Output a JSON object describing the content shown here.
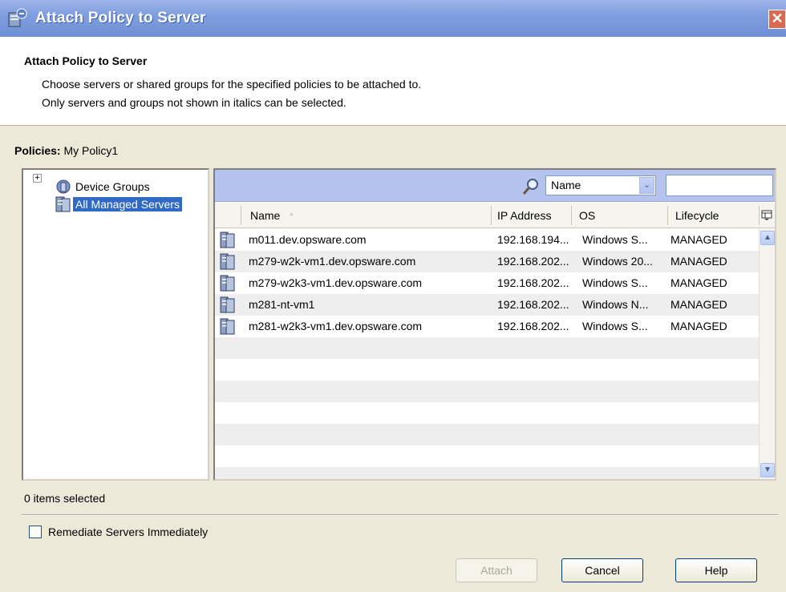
{
  "window": {
    "title": "Attach Policy to Server",
    "close_glyph": "✕"
  },
  "header": {
    "title": "Attach Policy to Server",
    "line1": "Choose servers or shared groups for the specified policies to be attached to.",
    "line2": "Only servers and groups not shown in italics can be selected."
  },
  "policies": {
    "label": "Policies:",
    "value": "My Policy1"
  },
  "tree": {
    "expander": "+",
    "items": [
      {
        "label": "Device Groups",
        "icon": "device-groups-icon"
      },
      {
        "label": "All Managed Servers",
        "icon": "server-icon"
      }
    ]
  },
  "search": {
    "field_selected": "Name",
    "field_arrow": "⌄",
    "query": ""
  },
  "table": {
    "columns": [
      {
        "label": "Name",
        "sort_glyph": "▲"
      },
      {
        "label": "IP Address"
      },
      {
        "label": "OS"
      },
      {
        "label": "Lifecycle"
      }
    ],
    "rows": [
      {
        "name": "m011.dev.opsware.com",
        "ip": "192.168.194...",
        "os": "Windows S...",
        "lifecycle": "MANAGED"
      },
      {
        "name": "m279-w2k-vm1.dev.opsware.com",
        "ip": "192.168.202...",
        "os": "Windows 20...",
        "lifecycle": "MANAGED"
      },
      {
        "name": "m279-w2k3-vm1.dev.opsware.com",
        "ip": "192.168.202...",
        "os": "Windows S...",
        "lifecycle": "MANAGED"
      },
      {
        "name": "m281-nt-vm1",
        "ip": "192.168.202...",
        "os": "Windows N...",
        "lifecycle": "MANAGED"
      },
      {
        "name": "m281-w2k3-vm1.dev.opsware.com",
        "ip": "192.168.202...",
        "os": "Windows S...",
        "lifecycle": "MANAGED"
      }
    ],
    "scroll_up": "▲",
    "scroll_down": "▼"
  },
  "status": {
    "items_selected": "0 items selected"
  },
  "options": {
    "remediate_label": "Remediate Servers Immediately",
    "remediate_checked": false
  },
  "buttons": {
    "attach": "Attach",
    "cancel": "Cancel",
    "help": "Help"
  }
}
